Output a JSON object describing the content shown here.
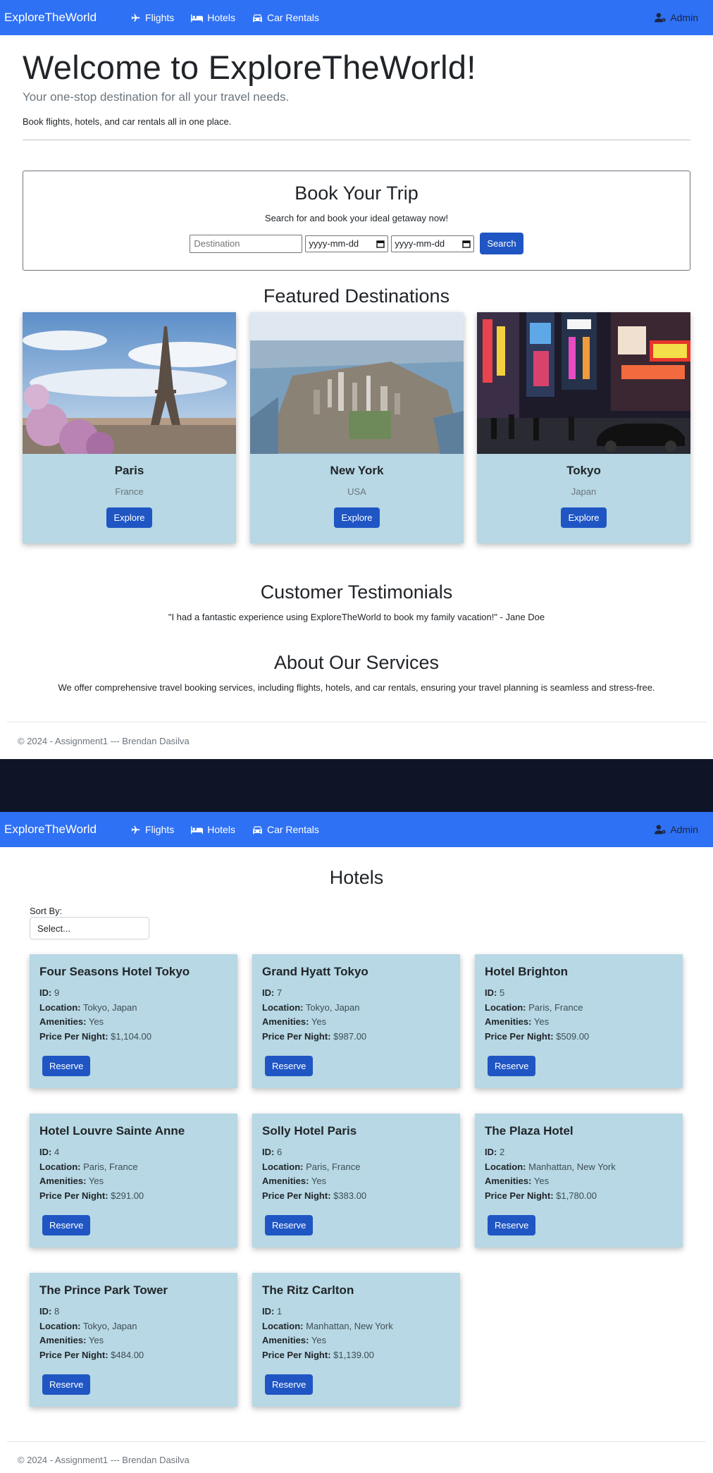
{
  "nav": {
    "brand": "ExploreTheWorld",
    "links": [
      "Flights",
      "Hotels",
      "Car Rentals"
    ],
    "admin": "Admin"
  },
  "hero": {
    "title": "Welcome to ExploreTheWorld!",
    "lead": "Your one-stop destination for all your travel needs.",
    "sub": "Book flights, hotels, and car rentals all in one place."
  },
  "book": {
    "title": "Book Your Trip",
    "subtitle": "Search for and book your ideal getaway now!",
    "destination_placeholder": "Destination",
    "date_placeholder": "yyyy-mm-dd",
    "search_label": "Search"
  },
  "featured": {
    "title": "Featured Destinations",
    "explore_label": "Explore",
    "cards": [
      {
        "name": "Paris",
        "country": "France"
      },
      {
        "name": "New York",
        "country": "USA"
      },
      {
        "name": "Tokyo",
        "country": "Japan"
      }
    ]
  },
  "testimonials": {
    "title": "Customer Testimonials",
    "quote": "\"I had a fantastic experience using ExploreTheWorld to book my family vacation!\" - Jane Doe"
  },
  "about": {
    "title": "About Our Services",
    "text": "We offer comprehensive travel booking services, including flights, hotels, and car rentals, ensuring your travel planning is seamless and stress-free."
  },
  "footer": "© 2024 - Assignment1 --- Brendan Dasilva",
  "hotels": {
    "title": "Hotels",
    "sort_label": "Sort By:",
    "sort_value": "Select...",
    "labels": {
      "id": "ID:",
      "location": "Location:",
      "amenities": "Amenities:",
      "price": "Price Per Night:"
    },
    "reserve_label": "Reserve",
    "items": [
      {
        "name": "Four Seasons Hotel Tokyo",
        "id": "9",
        "location": "Tokyo, Japan",
        "amenities": "Yes",
        "price": "$1,104.00"
      },
      {
        "name": "Grand Hyatt Tokyo",
        "id": "7",
        "location": "Tokyo, Japan",
        "amenities": "Yes",
        "price": "$987.00"
      },
      {
        "name": "Hotel Brighton",
        "id": "5",
        "location": "Paris, France",
        "amenities": "Yes",
        "price": "$509.00"
      },
      {
        "name": "Hotel Louvre Sainte Anne",
        "id": "4",
        "location": "Paris, France",
        "amenities": "Yes",
        "price": "$291.00"
      },
      {
        "name": "Solly Hotel Paris",
        "id": "6",
        "location": "Paris, France",
        "amenities": "Yes",
        "price": "$383.00"
      },
      {
        "name": "The Plaza Hotel",
        "id": "2",
        "location": "Manhattan, New York",
        "amenities": "Yes",
        "price": "$1,780.00"
      },
      {
        "name": "The Prince Park Tower",
        "id": "8",
        "location": "Tokyo, Japan",
        "amenities": "Yes",
        "price": "$484.00"
      },
      {
        "name": "The Ritz Carlton",
        "id": "1",
        "location": "Manhattan, New York",
        "amenities": "Yes",
        "price": "$1,139.00"
      }
    ]
  }
}
